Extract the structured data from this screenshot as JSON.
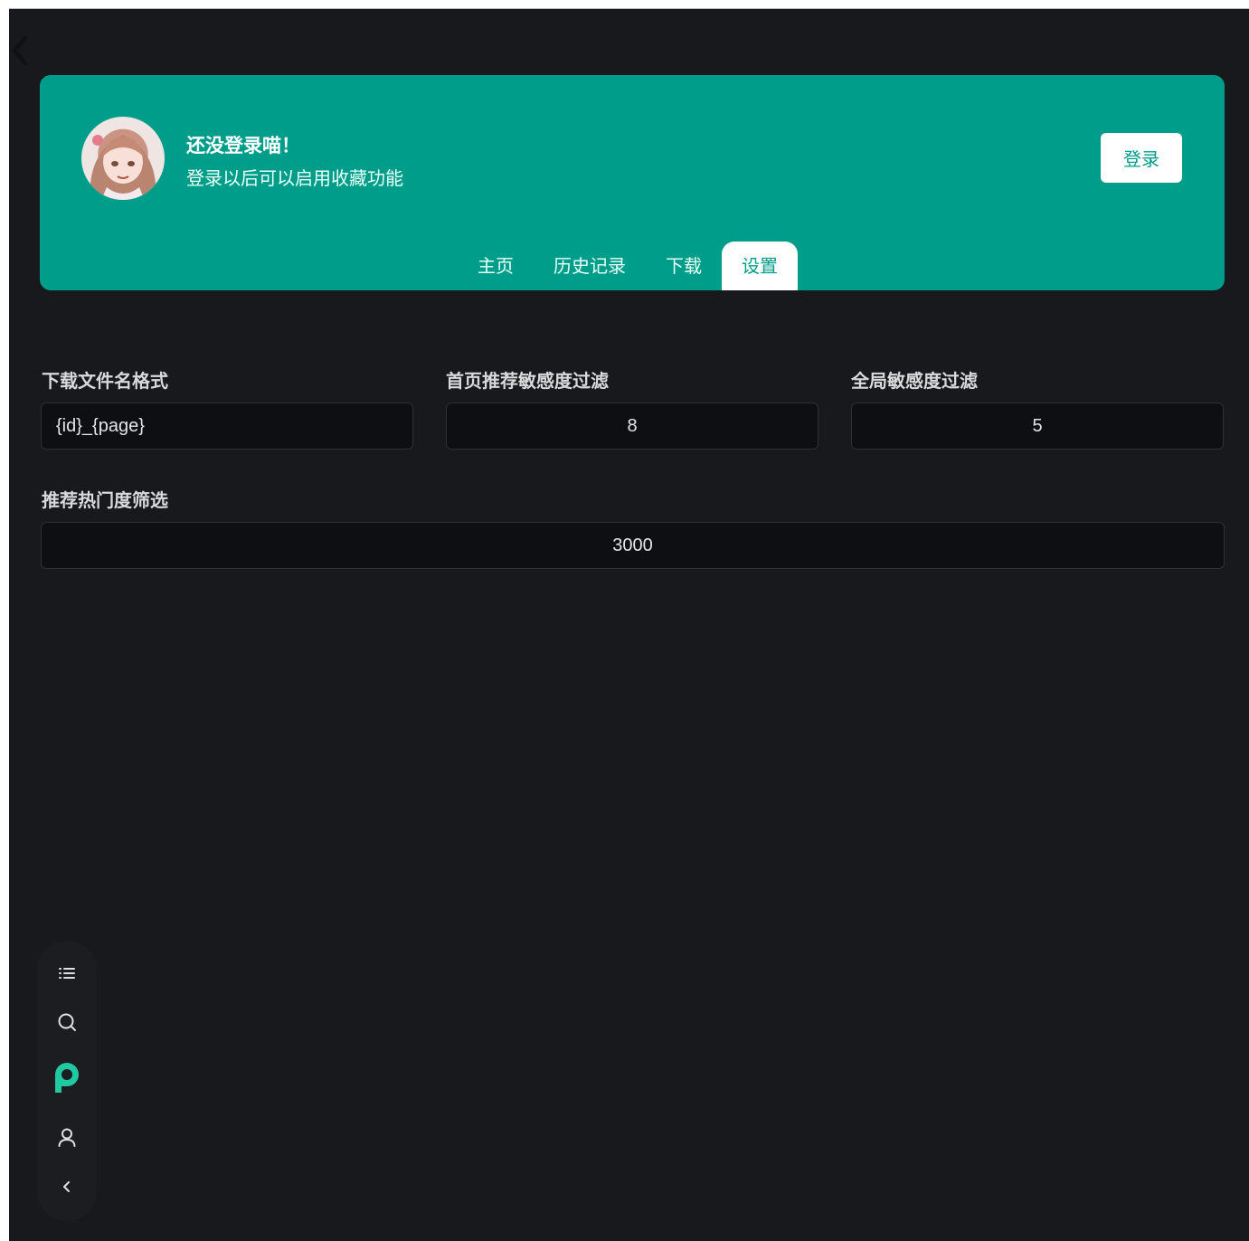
{
  "header": {
    "greeting_title": "还没登录喵！",
    "greeting_subtitle": "登录以后可以启用收藏功能",
    "login_label": "登录",
    "tabs": [
      {
        "label": "主页",
        "active": false
      },
      {
        "label": "历史记录",
        "active": false
      },
      {
        "label": "下载",
        "active": false
      },
      {
        "label": "设置",
        "active": true
      }
    ]
  },
  "settings": {
    "filename_format": {
      "label": "下载文件名格式",
      "value": "{id}_{page}"
    },
    "home_sensitivity": {
      "label": "首页推荐敏感度过滤",
      "value": "8"
    },
    "global_sensitivity": {
      "label": "全局敏感度过滤",
      "value": "5"
    },
    "popularity_filter": {
      "label": "推荐热门度筛选",
      "value": "3000"
    }
  },
  "dock": {
    "icons": [
      "list-icon",
      "search-icon",
      "pixiv-logo-icon",
      "user-icon",
      "chevron-left-icon"
    ]
  },
  "colors": {
    "accent": "#009e8a",
    "background": "#17191d",
    "input_bg": "#0e0f12",
    "logo": "#21c9a3"
  }
}
